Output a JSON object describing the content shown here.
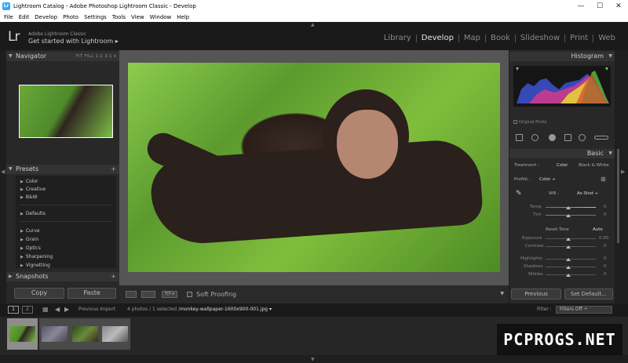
{
  "window": {
    "title": "Lightroom Catalog - Adobe Photoshop Lightroom Classic - Develop",
    "minimize": "—",
    "maximize": "☐",
    "close": "✕"
  },
  "menu": [
    "File",
    "Edit",
    "Develop",
    "Photo",
    "Settings",
    "Tools",
    "View",
    "Window",
    "Help"
  ],
  "identity": {
    "logo": "Lr",
    "brand": "Adobe Lightroom Classic",
    "subtitle": "Get started with Lightroom ▸"
  },
  "modules": [
    {
      "label": "Library",
      "active": false
    },
    {
      "label": "Develop",
      "active": true
    },
    {
      "label": "Map",
      "active": false
    },
    {
      "label": "Book",
      "active": false
    },
    {
      "label": "Slideshow",
      "active": false
    },
    {
      "label": "Print",
      "active": false
    },
    {
      "label": "Web",
      "active": false
    }
  ],
  "left": {
    "navigator": {
      "title": "Navigator",
      "options": "FIT  FILL  1:1  3:1 ▾"
    },
    "presets": {
      "title": "Presets",
      "groups_top": [
        "Color",
        "Creative",
        "B&W"
      ],
      "groups_mid": [
        "Defaults"
      ],
      "groups_bottom": [
        "Curve",
        "Grain",
        "Optics",
        "Sharpening",
        "Vignetting"
      ]
    },
    "snapshots": {
      "title": "Snapshots"
    },
    "copy_label": "Copy",
    "paste_label": "Paste"
  },
  "toolbar": {
    "soft_proofing": "Soft Proofing",
    "compare": "Y|Y ▾"
  },
  "right": {
    "histogram": {
      "title": "Histogram",
      "original_photo": "Original Photo"
    },
    "basic": {
      "title": "Basic",
      "treatment_label": "Treatment :",
      "treatment_color": "Color",
      "treatment_bw": "Black & White",
      "profile_label": "Profile :",
      "profile_value": "Color ÷",
      "wb_label": "WB :",
      "wb_value": "As Shot ÷",
      "temp_label": "Temp",
      "temp_value": "0",
      "tint_label": "Tint",
      "tint_value": "0",
      "tone_label": "Reset Tone",
      "auto_label": "Auto",
      "exposure_label": "Exposure",
      "exposure_value": "0.00",
      "contrast_label": "Contrast",
      "contrast_value": "0",
      "highlights_label": "Highlights",
      "highlights_value": "0",
      "shadows_label": "Shadows",
      "shadows_value": "0",
      "whites_label": "Whites",
      "whites_value": "0"
    },
    "previous_label": "Previous",
    "set_default_label": "Set Default..."
  },
  "filmstrip": {
    "monitor1": "1",
    "monitor2": "2",
    "source": "Previous Import",
    "count": "4 photos / 1 selected /",
    "filename": "monkey-wallpaper-1600x900-001.jpg ▾",
    "filter_label": "Filter :",
    "filter_value": "Filters Off ÷"
  },
  "watermark": "PCPROGS.NET",
  "colors": {
    "accent_active": "#e8e8e8",
    "module_inactive": "#8a8a8a",
    "panel_bg": "#282828"
  }
}
